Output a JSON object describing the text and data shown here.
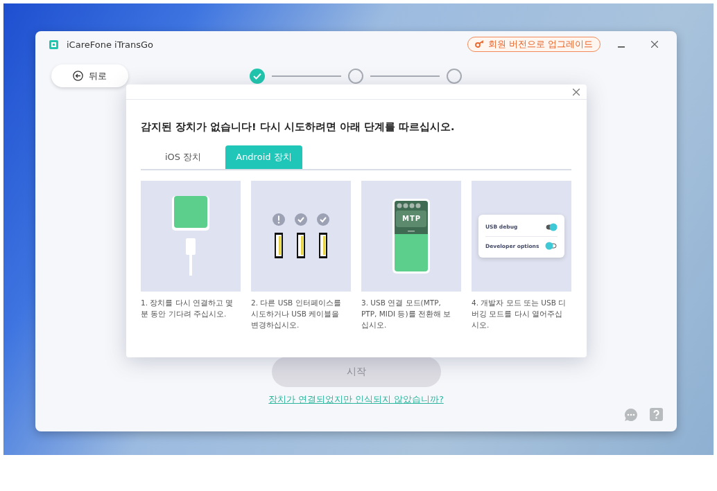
{
  "window": {
    "title": "iCareFone iTransGo",
    "upgrade_button": "회원 버전으로 업그레이드"
  },
  "back_button": "뒤로",
  "steps": [
    {
      "done": true
    },
    {
      "done": false
    },
    {
      "done": false
    }
  ],
  "start_button": {
    "label": "시작",
    "disabled": true
  },
  "help_link": "장치가 연결되었지만 인식되지 않았습니까?",
  "dialog": {
    "title": "감지된 장치가 없습니다! 다시 시도하려면 아래 단계를 따르십시오.",
    "tabs": [
      {
        "label": "iOS 장치",
        "selected": false
      },
      {
        "label": "Android 장치",
        "selected": true
      }
    ],
    "cards": [
      {
        "kind": "reconnect",
        "caption": "1. 장치를 다시 연결하고 몇 분 동안 기다려 주십시오."
      },
      {
        "kind": "ports",
        "caption": "2. 다른 USB 인터페이스를 시도하거나 USB 케이블을 변경하십시오.",
        "ports": [
          {
            "ok": false
          },
          {
            "ok": true
          },
          {
            "ok": true
          }
        ]
      },
      {
        "kind": "mode",
        "caption": "3. USB 연결 모드(MTP, PTP, MIDI 등)를 전환해 보십시오.",
        "mode_label": "MTP"
      },
      {
        "kind": "debug",
        "caption": "4. 개발자 모드 또는 USB 디버깅 모드를 다시 열어주십시오.",
        "options": [
          {
            "label": "USB debug",
            "on": true
          },
          {
            "label": "Developer options",
            "on": false
          }
        ]
      }
    ]
  }
}
